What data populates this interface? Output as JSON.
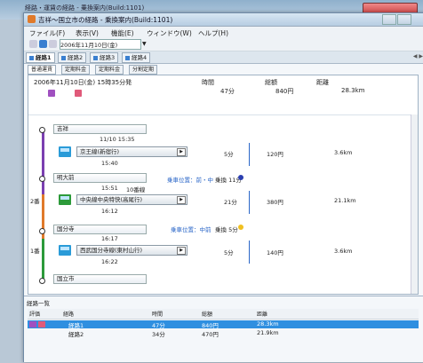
{
  "back_window": {
    "title": "経路・運賃の経路 - 乗換案内(Build:1101)"
  },
  "window": {
    "title": "吉祥〜国立市の経路 - 乗換案内(Build:1101)"
  },
  "menu": [
    "ファイル(F)",
    "表示(V)",
    "機能(E)",
    "ウィンドウ(W)",
    "ヘルプ(H)"
  ],
  "toolbar": {
    "date_value": "2006年11月10日(金)"
  },
  "route_tabs": [
    "経路1",
    "経路2",
    "経路3",
    "経路4"
  ],
  "sub_tabs": [
    "普通運賃",
    "定期料金",
    "定期料金",
    "分割定期"
  ],
  "summary": {
    "date_text": "2006年11月10日(金) 15時35分発",
    "time_label": "時間",
    "time_value": "47分",
    "fare_label": "総額",
    "fare_value": "840円",
    "distance_label": "距離",
    "distance_value": "28.3km"
  },
  "stations": [
    {
      "name": "吉祥"
    },
    {
      "name": "明大前"
    },
    {
      "name": "国分寺"
    },
    {
      "name": "国立市"
    }
  ],
  "legs": [
    {
      "depart": "11/10 15:35",
      "line": "京王線(新宿行)",
      "arrive": "15:40",
      "minutes": "5分",
      "fare": "120円",
      "dist": "3.6km",
      "note": "",
      "transfer": ""
    },
    {
      "depart": "15:51",
      "track": "10番線",
      "line": "中央線中央特快(高尾行)",
      "arrive": "16:12",
      "minutes": "21分",
      "fare": "380円",
      "dist": "21.1km",
      "note": "乗車位置：前・中",
      "transfer": "乗換 11分"
    },
    {
      "depart": "16:17",
      "line": "西武国分寺線(東村山行)",
      "arrive": "16:22",
      "minutes": "5分",
      "fare": "140円",
      "dist": "3.6km",
      "note": "乗車位置：中前",
      "transfer": "乗換 5分"
    }
  ],
  "track_side": [
    "2番",
    "1番"
  ],
  "list": {
    "title": "経路一覧",
    "headers": [
      "評価",
      "経路",
      "時間",
      "総額",
      "距離"
    ],
    "rows": [
      {
        "route": "経路1",
        "time": "47分",
        "fare": "840円",
        "dist": "28.3km"
      },
      {
        "route": "経路2",
        "time": "34分",
        "fare": "470円",
        "dist": "21.9km"
      }
    ]
  },
  "colors": {
    "accent": "#2f8fe0",
    "line1": "#7b3fb0",
    "line2": "#e07a2a",
    "line3": "#2c9a3a",
    "dot_blue": "#2b3fb0",
    "dot_yellow": "#f0c020"
  }
}
